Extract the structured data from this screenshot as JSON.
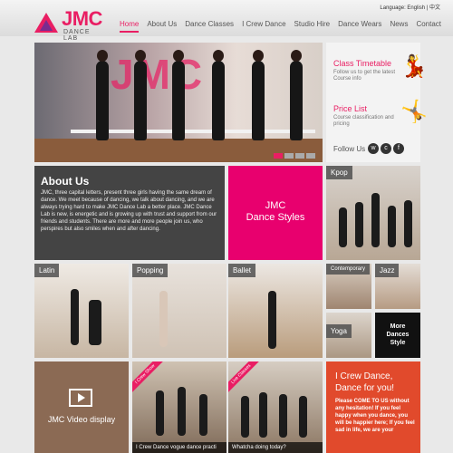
{
  "header": {
    "logo_text": "JMC",
    "logo_sub": "DANCE LAB",
    "language": "Language: English | 中文",
    "nav": [
      "Home",
      "About Us",
      "Dance Classes",
      "I Crew Dance",
      "Studio Hire",
      "Dance Wears",
      "News",
      "Contact"
    ]
  },
  "hero": {
    "watermark": "JMC"
  },
  "side": {
    "timetable_title": "Class Timetable",
    "timetable_desc": "Follow us to get the latest Course info",
    "price_title": "Price List",
    "price_desc": "Course classification and pricing",
    "follow_label": "Follow Us"
  },
  "about": {
    "title": "About Us",
    "body": "JMC, three capital letters, present three girls having the same dream of dance. We meet because of dancing, we talk about dancing, and we are always trying hard to make JMC Dance Lab a better place. JMC Dance Lab is new, is energetic and is growing up with trust and support from our friends and students. There are more and more people join us, who perspires but also smiles when and after dancing."
  },
  "styles_tile": {
    "line1": "JMC",
    "line2": "Dance Styles"
  },
  "tiles": {
    "kpop": "Kpop",
    "latin": "Latin",
    "popping": "Popping",
    "ballet": "Ballet",
    "contemporary": "Contemporary",
    "jazz": "Jazz",
    "yoga": "Yoga",
    "more_line1": "More",
    "more_line2": "Dances",
    "more_line3": "Style"
  },
  "video": {
    "label": "JMC  Video display"
  },
  "clips": [
    {
      "ribbon": "I Crew Show",
      "caption": "I Crew Dance vogue dance practi"
    },
    {
      "ribbon": "Live Classes",
      "caption": "Whatcha doing today?"
    }
  ],
  "promo": {
    "title": "I Crew Dance, Dance for you!",
    "body": "Please COME TO US without any hesitation! If you feel happy when you dance, you will be happier here; If you feel sad in life, we are your"
  },
  "colors": {
    "accent": "#e91e63",
    "promo": "#e14a2c",
    "about": "#444444"
  }
}
